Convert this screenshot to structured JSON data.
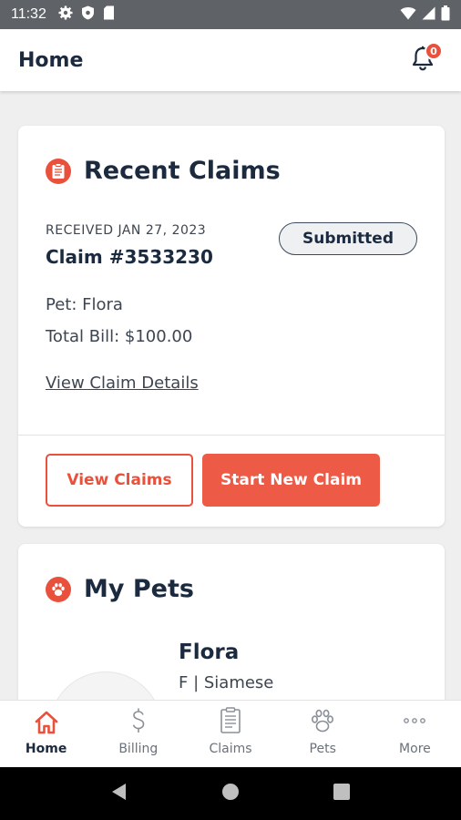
{
  "status_bar": {
    "time": "11:32",
    "left_icons": [
      "gear-icon",
      "shield-icon",
      "sim-card-icon"
    ],
    "right_icons": [
      "wifi-icon",
      "signal-icon",
      "battery-icon"
    ]
  },
  "app_bar": {
    "title": "Home",
    "notification_count": "0"
  },
  "recent_claims": {
    "title": "Recent Claims",
    "received": "RECEIVED JAN 27, 2023",
    "claim_number": "Claim #3533230",
    "status": "Submitted",
    "pet": "Pet: Flora",
    "total_bill": "Total Bill: $100.00",
    "details_link": "View Claim Details",
    "view_claims_label": "View Claims",
    "start_new_claim_label": "Start New Claim"
  },
  "my_pets": {
    "title": "My Pets",
    "pets": [
      {
        "name": "Flora",
        "info": "F | Siamese"
      }
    ]
  },
  "bottom_nav": {
    "items": [
      {
        "label": "Home",
        "icon": "home-icon",
        "active": true
      },
      {
        "label": "Billing",
        "icon": "dollar-icon",
        "active": false
      },
      {
        "label": "Claims",
        "icon": "document-icon",
        "active": false
      },
      {
        "label": "Pets",
        "icon": "paw-icon",
        "active": false
      },
      {
        "label": "More",
        "icon": "more-dots-icon",
        "active": false
      }
    ]
  },
  "colors": {
    "accent": "#e9513c",
    "navy": "#1b2a3e",
    "background": "#efefef"
  }
}
